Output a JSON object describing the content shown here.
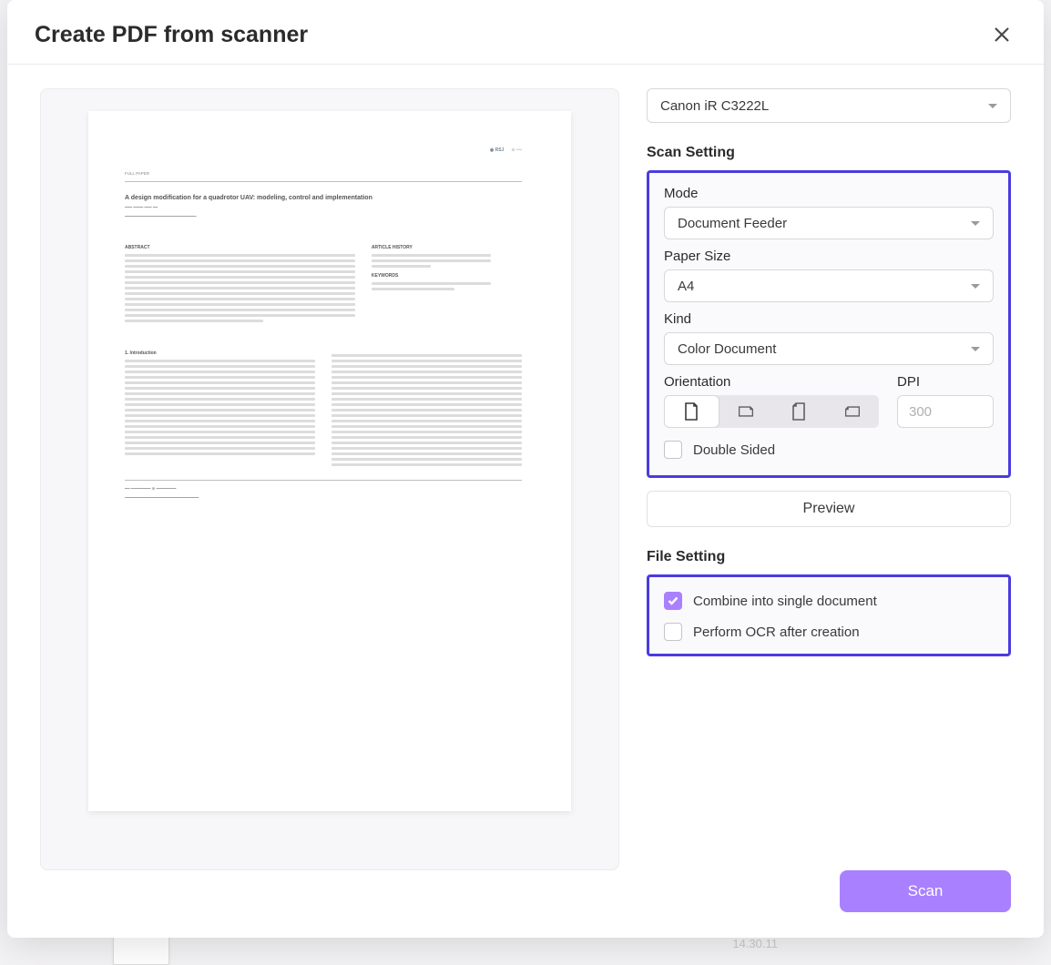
{
  "modal": {
    "title": "Create PDF from scanner"
  },
  "scanner": {
    "selected": "Canon iR C3222L"
  },
  "sections": {
    "scan": "Scan Setting",
    "file": "File Setting"
  },
  "fields": {
    "mode": {
      "label": "Mode",
      "value": "Document Feeder"
    },
    "paper": {
      "label": "Paper Size",
      "value": "A4"
    },
    "kind": {
      "label": "Kind",
      "value": "Color Document"
    },
    "orientation": {
      "label": "Orientation"
    },
    "dpi": {
      "label": "DPI",
      "value": "300"
    }
  },
  "checkboxes": {
    "double_sided": {
      "label": "Double Sided",
      "checked": false
    },
    "combine": {
      "label": "Combine into single document",
      "checked": true
    },
    "ocr": {
      "label": "Perform OCR after creation",
      "checked": false
    }
  },
  "buttons": {
    "preview": "Preview",
    "scan": "Scan"
  },
  "preview_doc": {
    "subject": "FULL PAPER",
    "title": "A design modification for a quadrotor UAV: modeling, control and implementation",
    "section": "1.  Introduction",
    "abstract": "ABSTRACT"
  },
  "bg_time": "14.30.11",
  "colors": {
    "accent_purple": "#a980ff",
    "highlight_blue": "#4a3ce0"
  }
}
